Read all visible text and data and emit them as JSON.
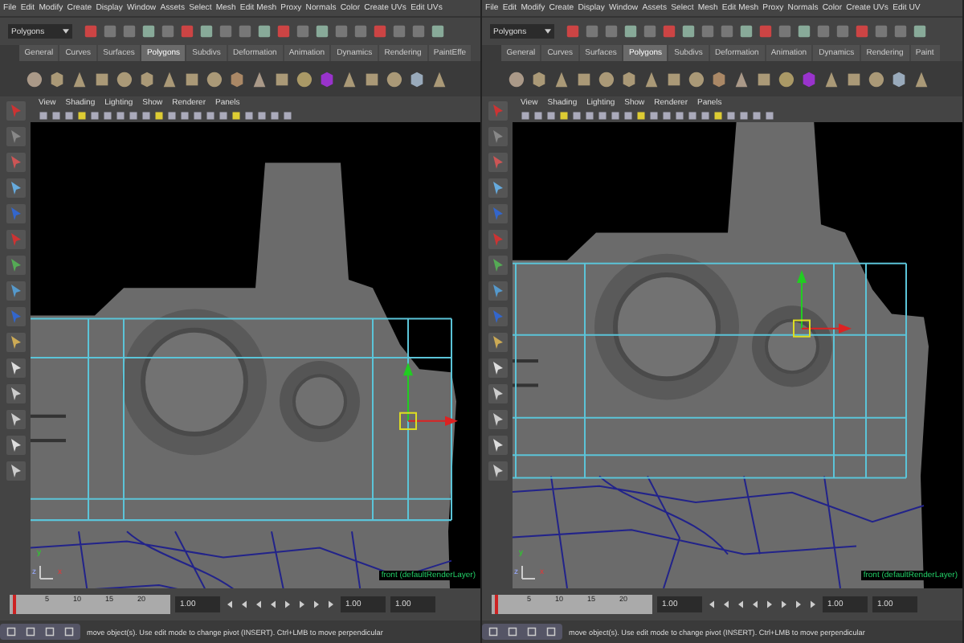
{
  "panels": [
    {
      "menu": [
        "File",
        "Edit",
        "Modify",
        "Create",
        "Display",
        "Window",
        "Assets",
        "Select",
        "Mesh",
        "Edit Mesh",
        "Proxy",
        "Normals",
        "Color",
        "Create UVs",
        "Edit UVs"
      ],
      "mode_dropdown": "Polygons",
      "shelf_tabs": [
        {
          "label": "General",
          "selected": false
        },
        {
          "label": "Curves",
          "selected": false
        },
        {
          "label": "Surfaces",
          "selected": false
        },
        {
          "label": "Polygons",
          "selected": true
        },
        {
          "label": "Subdivs",
          "selected": false
        },
        {
          "label": "Deformation",
          "selected": false
        },
        {
          "label": "Animation",
          "selected": false
        },
        {
          "label": "Dynamics",
          "selected": false
        },
        {
          "label": "Rendering",
          "selected": false
        },
        {
          "label": "PaintEffe",
          "selected": false
        }
      ],
      "viewport_menu": [
        "View",
        "Shading",
        "Lighting",
        "Show",
        "Renderer",
        "Panels"
      ],
      "axis_labels": [
        "y",
        "z",
        "x"
      ],
      "camera_label": "front (defaultRenderLayer)",
      "timeline": {
        "ticks": [
          "5",
          "10",
          "15",
          "20"
        ],
        "level": 0.02,
        "current": "1.00",
        "range_start": "1.00",
        "range_end": "1.00"
      },
      "help_line": "move object(s). Use edit mode to change pivot (INSERT).  Ctrl+LMB to move perpendicular"
    },
    {
      "menu": [
        "File",
        "Edit",
        "Modify",
        "Create",
        "Display",
        "Window",
        "Assets",
        "Select",
        "Mesh",
        "Edit Mesh",
        "Proxy",
        "Normals",
        "Color",
        "Create UVs",
        "Edit UV"
      ],
      "mode_dropdown": "Polygons",
      "shelf_tabs": [
        {
          "label": "General",
          "selected": false
        },
        {
          "label": "Curves",
          "selected": false
        },
        {
          "label": "Surfaces",
          "selected": false
        },
        {
          "label": "Polygons",
          "selected": true
        },
        {
          "label": "Subdivs",
          "selected": false
        },
        {
          "label": "Deformation",
          "selected": false
        },
        {
          "label": "Animation",
          "selected": false
        },
        {
          "label": "Dynamics",
          "selected": false
        },
        {
          "label": "Rendering",
          "selected": false
        },
        {
          "label": "Paint",
          "selected": false
        }
      ],
      "viewport_menu": [
        "View",
        "Shading",
        "Lighting",
        "Show",
        "Renderer",
        "Panels"
      ],
      "axis_labels": [
        "y",
        "z",
        "x"
      ],
      "camera_label": "front (defaultRenderLayer)",
      "timeline": {
        "ticks": [
          "5",
          "10",
          "15",
          "20"
        ],
        "level": 0.02,
        "current": "1.00",
        "range_start": "1.00",
        "range_end": "1.00"
      },
      "help_line": "move object(s). Use edit mode to change pivot (INSERT).  Ctrl+LMB to move perpendicular"
    }
  ]
}
